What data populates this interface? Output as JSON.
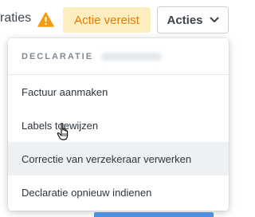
{
  "header": {
    "breadcrumb_fragment": "raties",
    "status_badge": "Actie vereist",
    "actions_button": "Acties"
  },
  "menu": {
    "header": "DECLARATIE",
    "items": [
      {
        "label": "Factuur aanmaken"
      },
      {
        "label": "Labels toewijzen"
      },
      {
        "label": "Correctie van verzekeraar verwerken"
      },
      {
        "label": "Declaratie opnieuw indienen"
      }
    ],
    "hovered_index": 2
  },
  "colors": {
    "warning": "#f39c12",
    "badge_bg": "#fdeec0",
    "badge_text": "#e47a0c",
    "primary": "#4d8fe0"
  }
}
